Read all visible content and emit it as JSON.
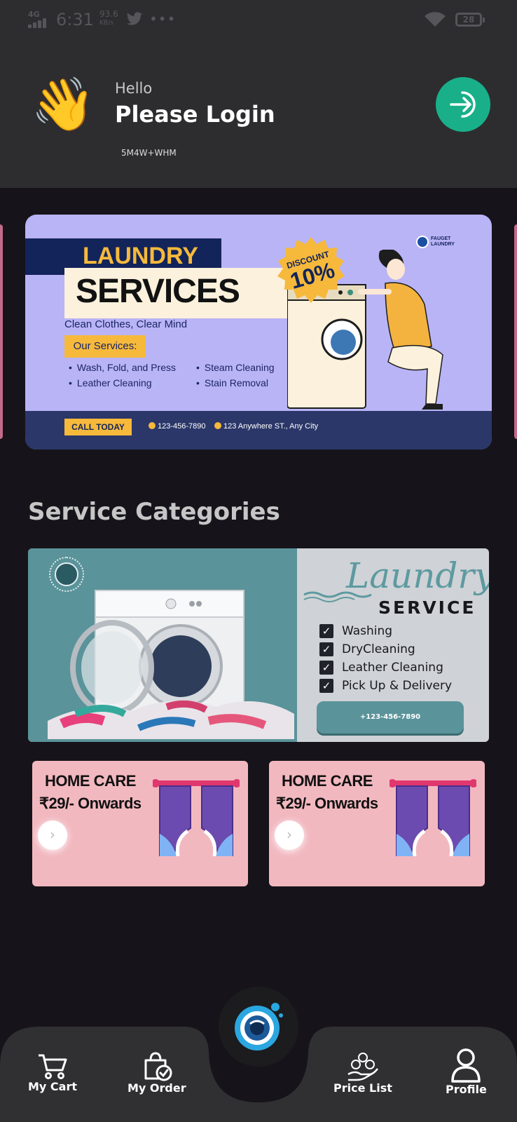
{
  "status_bar": {
    "network": "4G",
    "time": "6:31",
    "speed_value": "93.6",
    "speed_unit": "KB/s",
    "more": "•••",
    "battery": "28"
  },
  "header": {
    "greeting": "Hello",
    "title": "Please Login",
    "location_code": "5M4W+WHM",
    "wave_icon": "waving-hand-icon",
    "login_icon": "login-arrow-icon"
  },
  "promo_banner": {
    "label": "LAUNDRY",
    "heading": "SERVICES",
    "tagline": "Clean Clothes, Clear Mind",
    "our_services": "Our Services:",
    "services": [
      "Wash, Fold, and Press",
      "Leather Cleaning",
      "Steam Cleaning",
      "Stain Removal"
    ],
    "discount_label": "DISCOUNT",
    "discount_value": "10%",
    "brand_line1": "FAUGET",
    "brand_line2": "LAUNDRY",
    "cta": "CALL TODAY",
    "phone": "123-456-7890",
    "address": "123 Anywhere ST., Any City"
  },
  "section_title": "Service Categories",
  "category_banner": {
    "script_title": "Laundry",
    "subtitle": "SERVICE",
    "items": [
      "Washing",
      "DryCleaning",
      "Leather Cleaning",
      "Pick Up & Delivery"
    ],
    "check": "✓",
    "phone": "+123-456-7890"
  },
  "cards": [
    {
      "title": "HOME CARE",
      "price": "₹29/- Onwards",
      "arrow": "›"
    },
    {
      "title": "HOME CARE",
      "price": "₹29/- Onwards",
      "arrow": "›"
    }
  ],
  "bottom_nav": {
    "cart": "My Cart",
    "order": "My Order",
    "price_list": "Price List",
    "profile": "Profile"
  },
  "colors": {
    "background": "#16141a",
    "header": "#2d2d2f",
    "accent_green": "#19b089",
    "card_pink": "#f2b8c0",
    "banner_lavender": "#b9b4f6",
    "banner_teal": "#5a939a"
  }
}
